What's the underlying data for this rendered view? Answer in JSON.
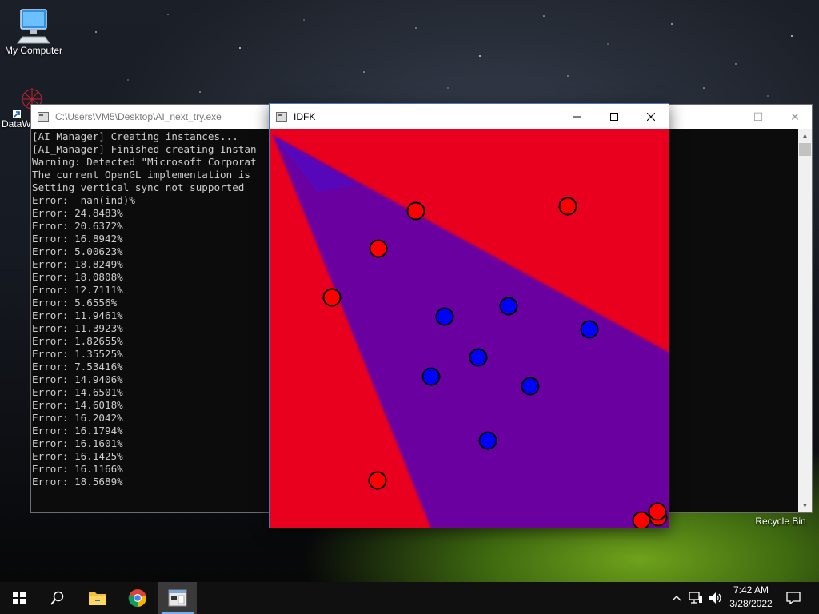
{
  "desktop": {
    "icons": [
      {
        "label": "My Computer"
      },
      {
        "label": "Recycle Bin"
      },
      {
        "label": "DataW"
      }
    ]
  },
  "console_window": {
    "title": "C:\\Users\\VM5\\Desktop\\AI_next_try.exe",
    "lines": [
      "[AI_Manager] Creating instances...",
      "[AI_Manager] Finished creating Instan",
      "Warning: Detected \"Microsoft Corporat",
      "The current OpenGL implementation is",
      "Setting vertical sync not supported",
      "Error: -nan(ind)%",
      "Error: 24.8483%",
      "Error: 20.6372%",
      "Error: 16.8942%",
      "Error: 5.00623%",
      "Error: 18.8249%",
      "Error: 18.0808%",
      "Error: 12.7111%",
      "Error: 5.6556%",
      "Error: 11.9461%",
      "Error: 11.3923%",
      "Error: 1.82655%",
      "Error: 1.35525%",
      "Error: 7.53416%",
      "Error: 14.9406%",
      "Error: 14.6501%",
      "Error: 14.6018%",
      "Error: 16.2042%",
      "Error: 16.1794%",
      "Error: 16.1601%",
      "Error: 16.1425%",
      "Error: 16.1166%",
      "Error: 18.5689%"
    ]
  },
  "idfk_window": {
    "title": "IDFK",
    "colors": {
      "region_red": "#e8001e",
      "region_purple": "#6a00a0",
      "edge_blue": "#4a10d0",
      "point_red": "#ff0000",
      "point_blue": "#0000ff",
      "outline": "#000000"
    }
  },
  "taskbar": {
    "time": "7:42 AM",
    "date": "3/28/2022",
    "pinned": [
      {
        "icon": "windows-start-icon"
      },
      {
        "icon": "search-icon"
      },
      {
        "icon": "file-explorer-icon"
      },
      {
        "icon": "chrome-icon"
      },
      {
        "icon": "console-app-icon"
      }
    ],
    "tray_icons": [
      "chevron-up-icon",
      "network-icon",
      "volume-icon",
      "notification-icon"
    ]
  }
}
